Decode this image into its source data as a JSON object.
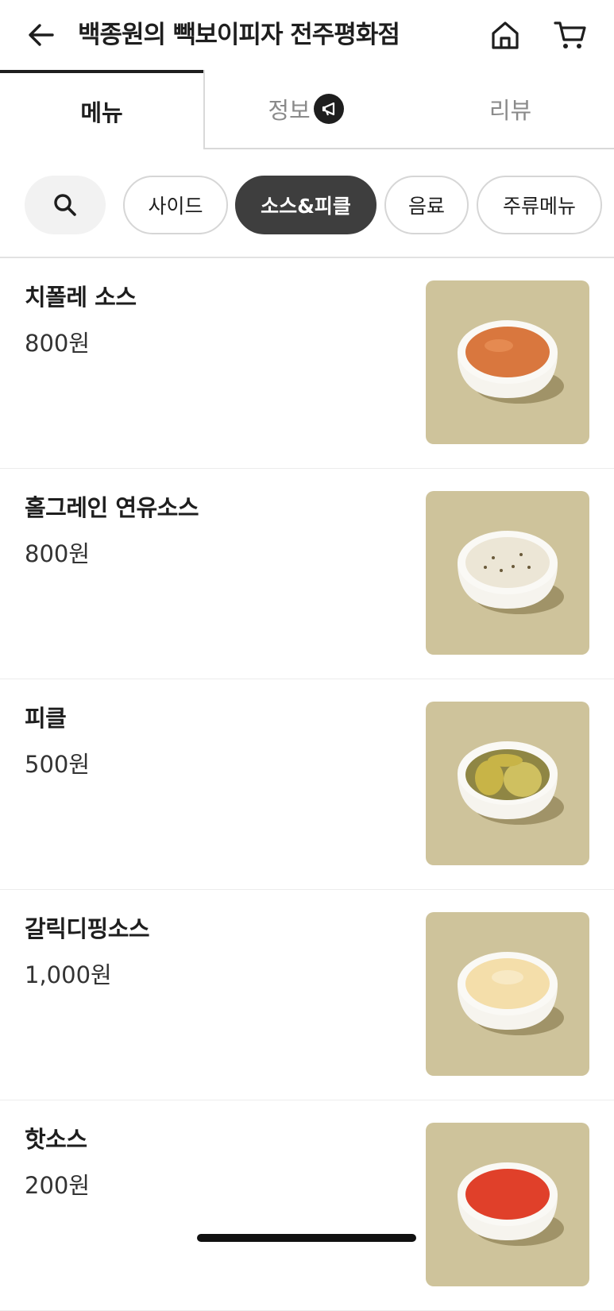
{
  "header": {
    "title": "백종원의 빽보이피자 전주평화점",
    "back_icon": "arrow-left-icon",
    "home_icon": "home-icon",
    "cart_icon": "cart-icon"
  },
  "tabs": [
    {
      "label": "메뉴",
      "active": true
    },
    {
      "label": "정보",
      "active": false,
      "badge_icon": "megaphone-icon"
    },
    {
      "label": "리뷰",
      "active": false
    }
  ],
  "categories": {
    "search_icon": "search-icon",
    "chips": [
      {
        "label": "사이드",
        "active": false
      },
      {
        "label": "소스&피클",
        "active": true
      },
      {
        "label": "음료",
        "active": false
      },
      {
        "label": "주류메뉴",
        "active": false
      }
    ]
  },
  "menu_items": [
    {
      "name": "치폴레 소스",
      "price": "800원",
      "sauce_color": "#d9773e"
    },
    {
      "name": "홀그레인 연유소스",
      "price": "800원",
      "sauce_color": "#ece6d6"
    },
    {
      "name": "피클",
      "price": "500원",
      "sauce_color": "#c8b447"
    },
    {
      "name": "갈릭디핑소스",
      "price": "1,000원",
      "sauce_color": "#f4deaa"
    },
    {
      "name": "핫소스",
      "price": "200원",
      "sauce_color": "#e0402a"
    }
  ],
  "colors": {
    "active_chip": "#3e3e3e",
    "image_bg": "#cec39b"
  }
}
